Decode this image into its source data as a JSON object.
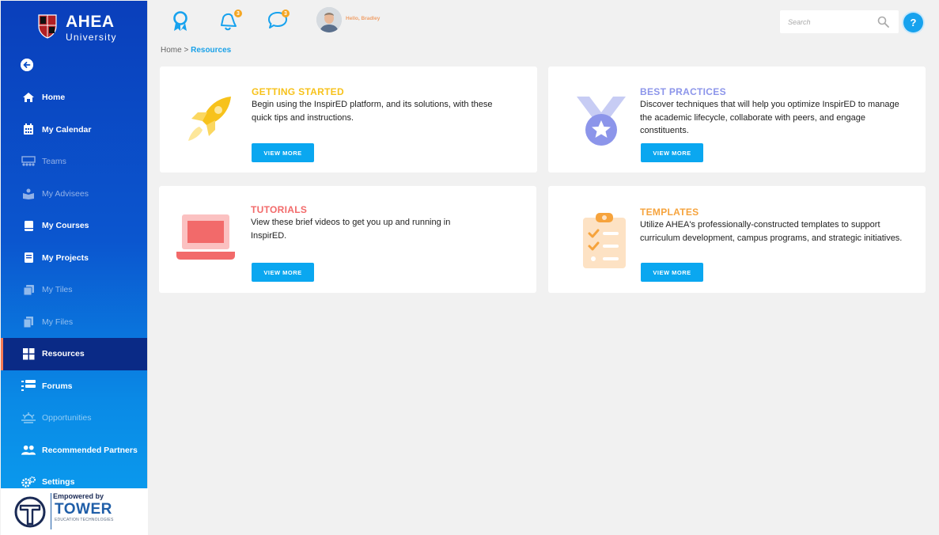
{
  "brand": {
    "title": "AHEA",
    "subtitle": "University",
    "crest_letters": [
      "A",
      "H",
      "E",
      "A"
    ]
  },
  "sidebar": {
    "items": [
      {
        "label": "Home",
        "icon": "home-icon"
      },
      {
        "label": "My Calendar",
        "icon": "calendar-icon"
      },
      {
        "label": "Teams",
        "icon": "teams-icon"
      },
      {
        "label": "My Advisees",
        "icon": "advisees-icon"
      },
      {
        "label": "My Courses",
        "icon": "book-icon"
      },
      {
        "label": "My Projects",
        "icon": "projects-icon"
      },
      {
        "label": "My Tiles",
        "icon": "tiles-icon"
      },
      {
        "label": "My Files",
        "icon": "files-icon"
      },
      {
        "label": "Resources",
        "icon": "grid-icon"
      },
      {
        "label": "Forums",
        "icon": "forums-icon"
      },
      {
        "label": "Opportunities",
        "icon": "opportunities-icon"
      },
      {
        "label": "Recommended Partners",
        "icon": "partners-icon"
      },
      {
        "label": "Settings",
        "icon": "gear-icon"
      }
    ],
    "active": "Resources"
  },
  "footer": {
    "empowered_label": "Empowered by",
    "company": "TOWER",
    "company_sub": "EDUCATION TECHNOLOGIES"
  },
  "topbar": {
    "notifications_count": "3",
    "messages_count": "3",
    "greeting": "Hello, Bradley",
    "search_placeholder": "Search",
    "help_label": "?"
  },
  "breadcrumb": {
    "home": "Home",
    "separator": ">",
    "current": "Resources"
  },
  "cards": [
    {
      "title": "GETTING STARTED",
      "title_color": "#f7c21b",
      "description": "Begin using the InspirED platform, and its solutions, with these quick tips and instructions.",
      "button": "VIEW MORE",
      "icon": "rocket-icon"
    },
    {
      "title": "BEST PRACTICES",
      "title_color": "#8c95ea",
      "description": "Discover techniques that will help you optimize InspirED to manage the academic lifecycle, collaborate with peers, and engage constituents.",
      "button": "VIEW MORE",
      "icon": "medal-icon"
    },
    {
      "title": "TUTORIALS",
      "title_color": "#f26a6a",
      "description": "View these brief videos to get you up and running in InspirED.",
      "button": "VIEW MORE",
      "icon": "laptop-icon"
    },
    {
      "title": "TEMPLATES",
      "title_color": "#f6a33c",
      "description": "Utilize AHEA's professionally-constructed templates to support curriculum development, campus programs, and strategic initiatives.",
      "button": "VIEW MORE",
      "icon": "clipboard-icon"
    }
  ]
}
